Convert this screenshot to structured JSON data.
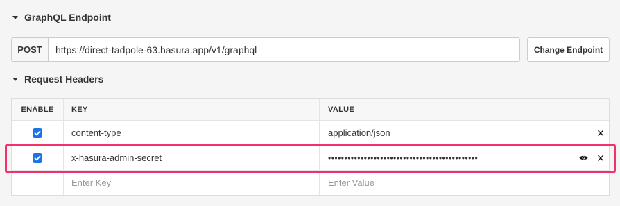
{
  "endpoint": {
    "title": "GraphQL Endpoint",
    "method": "POST",
    "url": "https://direct-tadpole-63.hasura.app/v1/graphql",
    "change_button": "Change Endpoint"
  },
  "headers": {
    "title": "Request Headers",
    "columns": {
      "enable": "ENABLE",
      "key": "KEY",
      "value": "VALUE"
    },
    "rows": [
      {
        "enabled": true,
        "key": "content-type",
        "value": "application/json"
      },
      {
        "enabled": true,
        "key": "x-hasura-admin-secret",
        "value": "••••••••••••••••••••••••••••••••••••••••••••••"
      }
    ],
    "new_row": {
      "key_placeholder": "Enter Key",
      "value_placeholder": "Enter Value"
    }
  },
  "colors": {
    "highlight": "#f2306b",
    "checkbox": "#1a73e8"
  }
}
